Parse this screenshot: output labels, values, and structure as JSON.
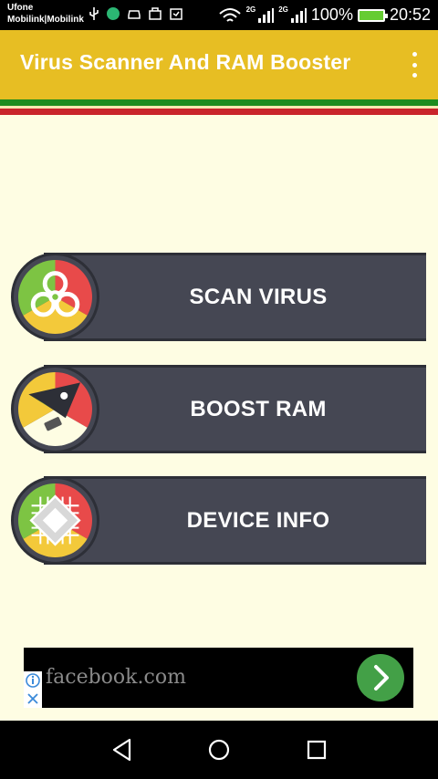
{
  "status_bar": {
    "carrier_1": "Ufone",
    "carrier_2": "Mobilink|Mobilink",
    "network_1": "2G",
    "network_2": "2G",
    "battery": "100%",
    "time": "20:52"
  },
  "app_bar": {
    "title": "Virus Scanner And RAM Booster"
  },
  "features": [
    {
      "label": "SCAN VIRUS"
    },
    {
      "label": "BOOST RAM"
    },
    {
      "label": "DEVICE INFO"
    }
  ],
  "ad": {
    "text": "facebook.com"
  },
  "colors": {
    "app_bar": "#E7BE23",
    "background": "#FEFDE3",
    "button_bg": "#454753",
    "stripe_green": "#1E8C1E",
    "stripe_red": "#C9252B",
    "ad_arrow": "#43A047"
  },
  "icons": {
    "scan": "biohazard-icon",
    "boost": "rocket-icon",
    "device": "chip-icon"
  }
}
